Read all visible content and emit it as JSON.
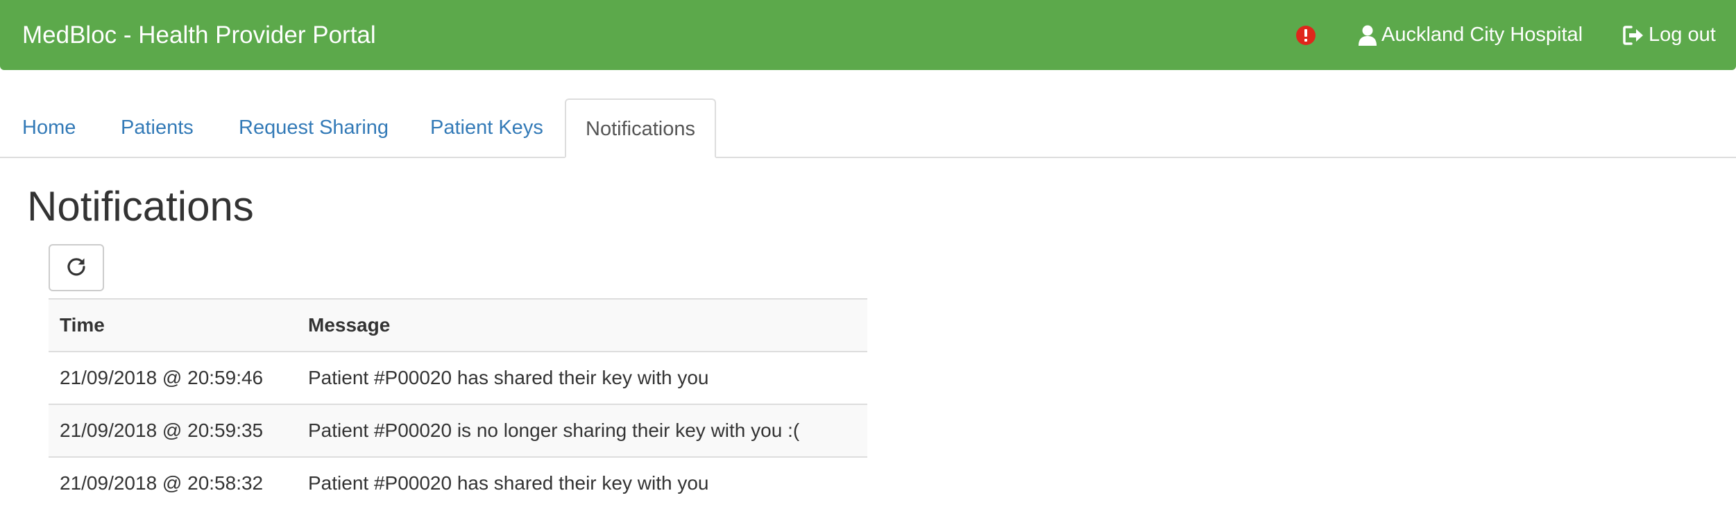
{
  "navbar": {
    "brand": "MedBloc - Health Provider Portal",
    "alert_icon": "exclamation-circle-icon",
    "alert_color": "#e0261b",
    "hospital": "Auckland City Hospital",
    "hospital_icon": "user-icon",
    "logout": "Log out",
    "logout_icon": "log-out-icon",
    "bg_color": "#5ca94b"
  },
  "tabs": [
    {
      "label": "Home"
    },
    {
      "label": "Patients"
    },
    {
      "label": "Request Sharing"
    },
    {
      "label": "Patient Keys"
    },
    {
      "label": "Notifications",
      "active": true
    }
  ],
  "page": {
    "title": "Notifications",
    "refresh_icon": "refresh-icon"
  },
  "table": {
    "headers": [
      "Time",
      "Message"
    ],
    "rows": [
      {
        "time": "21/09/2018 @ 20:59:46",
        "message": "Patient #P00020 has shared their key with you"
      },
      {
        "time": "21/09/2018 @ 20:59:35",
        "message": "Patient #P00020 is no longer sharing their key with you :("
      },
      {
        "time": "21/09/2018 @ 20:58:32",
        "message": "Patient #P00020 has shared their key with you"
      }
    ]
  }
}
